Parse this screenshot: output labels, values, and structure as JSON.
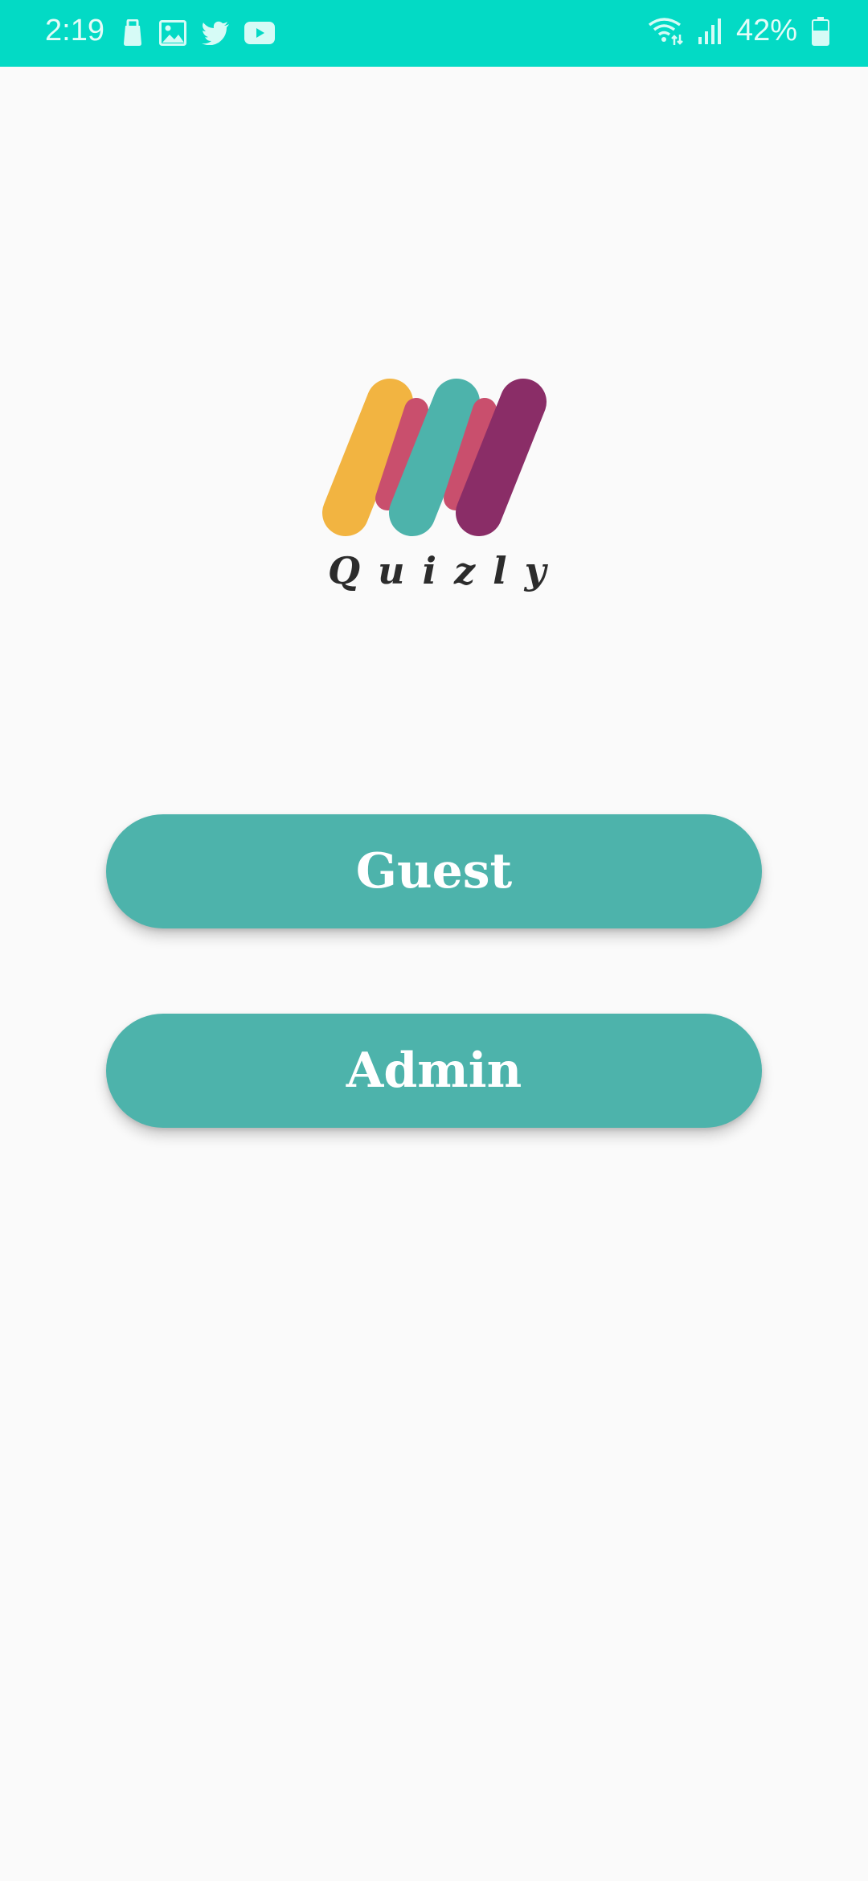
{
  "status_bar": {
    "time": "2:19",
    "battery_percent": "42%",
    "notification_icons": [
      "briefcase-icon",
      "image-icon",
      "twitter-icon",
      "youtube-icon"
    ],
    "system_icons": [
      "wifi-icon",
      "signal-icon",
      "battery-icon"
    ],
    "background_color": "#03dac5"
  },
  "app": {
    "logo_text": "Quizly",
    "logo_colors": [
      "#f2b441",
      "#c94f6d",
      "#4db3ab",
      "#8a2d67"
    ]
  },
  "buttons": {
    "guest_label": "Guest",
    "admin_label": "Admin",
    "color": "#4db3ab"
  }
}
